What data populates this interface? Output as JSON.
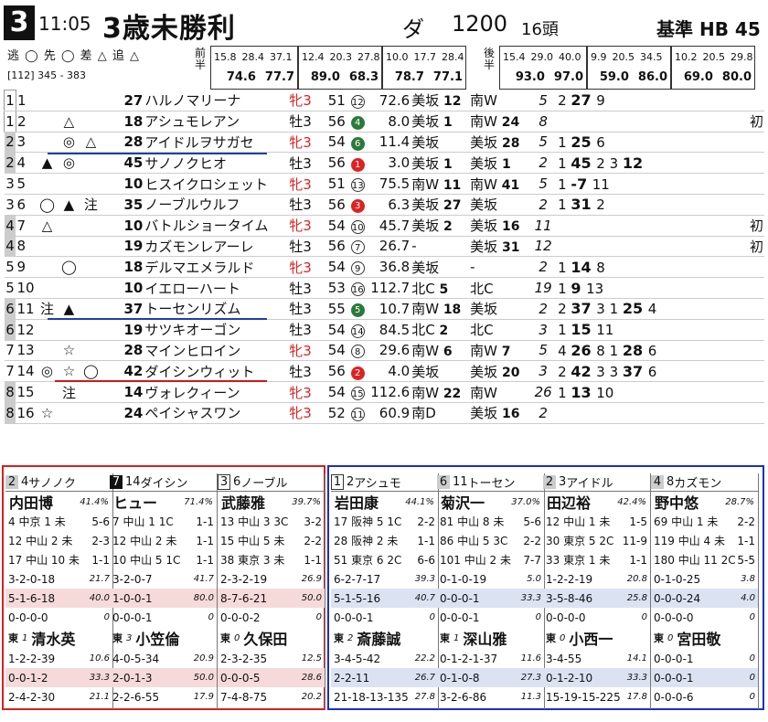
{
  "header": {
    "race_no": "3",
    "time": "11:05",
    "title": "3歳未勝利",
    "course": "ダ",
    "distance": "1200",
    "heads": "16頭",
    "standard": "基準 HB 45",
    "legend": "逃 ◯ 先 ◯ 差 △ 追 △",
    "legend_nums": "[112]  345 - 383",
    "label_zen": "前半",
    "label_kou": "後半"
  },
  "laps_left": [
    {
      "r1": [
        "15.8",
        "28.4",
        "37.1"
      ],
      "r2": [
        "74.6",
        "77.7"
      ]
    },
    {
      "r1": [
        "12.4",
        "20.3",
        "27.8"
      ],
      "r2": [
        "89.0",
        "68.3"
      ]
    },
    {
      "r1": [
        "10.0",
        "17.7",
        "28.4"
      ],
      "r2": [
        "78.7",
        "77.1"
      ]
    }
  ],
  "laps_right": [
    {
      "r1": [
        "15.4",
        "29.0",
        "40.0"
      ],
      "r2": [
        "93.0",
        "97.0"
      ]
    },
    {
      "r1": [
        "9.9",
        "20.5",
        "34.5"
      ],
      "r2": [
        "59.0",
        "86.0"
      ]
    },
    {
      "r1": [
        "10.2",
        "20.5",
        "29.8"
      ],
      "r2": [
        "69.0",
        "80.0"
      ]
    }
  ],
  "runners": [
    {
      "waku": "1",
      "wk": "w1",
      "num": "1",
      "m1": "",
      "m2": "",
      "m3": "",
      "idx": "27",
      "name": "ハルノマリーナ",
      "sex": "牝3",
      "kg": "51",
      "pop": "12",
      "pc": "c",
      "odds": "72.6",
      "trainer": "美坂",
      "t_n": "12",
      "course": "南W",
      "c_n": "",
      "rank": "5",
      "hist": "2 27 9",
      "extra": ""
    },
    {
      "waku": "1",
      "wk": "w1",
      "num": "2",
      "m1": "",
      "m2": "△",
      "m3": "",
      "idx": "18",
      "name": "アシュモレアン",
      "sex": "牡3",
      "kg": "56",
      "pop": "4",
      "pc": "grn",
      "odds": "8.0",
      "trainer": "美坂",
      "t_n": "1",
      "course": "南W",
      "c_n": "24",
      "rank": "8",
      "hist": "",
      "extra": "初"
    },
    {
      "waku": "2",
      "wk": "w2",
      "num": "3",
      "m1": "",
      "m2": "◎",
      "m3": "△",
      "idx": "28",
      "name": "アイドルヲサガセ",
      "sex": "牝3",
      "kg": "54",
      "pop": "6",
      "pc": "grn",
      "odds": "11.4",
      "trainer": "美坂",
      "t_n": "",
      "course": "美坂",
      "c_n": "28",
      "rank": "5",
      "hist": "1 25 6",
      "extra": ""
    },
    {
      "waku": "2",
      "wk": "w2",
      "num": "4",
      "m1": "▲",
      "m2": "◎",
      "m3": "",
      "idx": "45",
      "name": "サノノクヒオ",
      "sex": "牡3",
      "kg": "56",
      "pop": "1",
      "pc": "red",
      "odds": "3.0",
      "trainer": "美坂",
      "t_n": "1",
      "course": "美坂",
      "c_n": "1",
      "rank": "2",
      "hist": "1 45 2 3 12",
      "extra": ""
    },
    {
      "waku": "3",
      "wk": "w3",
      "num": "5",
      "m1": "",
      "m2": "",
      "m3": "",
      "idx": "10",
      "name": "ヒスイクロシェット",
      "sex": "牝3",
      "kg": "51",
      "pop": "13",
      "pc": "c",
      "odds": "75.5",
      "trainer": "南W",
      "t_n": "11",
      "course": "南W",
      "c_n": "41",
      "rank": "5",
      "hist": "1 -7 11",
      "extra": ""
    },
    {
      "waku": "3",
      "wk": "w3",
      "num": "6",
      "m1": "◯",
      "m2": "▲",
      "m3": "注",
      "idx": "35",
      "name": "ノーブルウルフ",
      "sex": "牡3",
      "kg": "56",
      "pop": "3",
      "pc": "red",
      "odds": "6.3",
      "trainer": "美坂",
      "t_n": "27",
      "course": "美坂",
      "c_n": "",
      "rank": "2",
      "hist": "1 31 2",
      "extra": ""
    },
    {
      "waku": "4",
      "wk": "w4",
      "num": "7",
      "m1": "△",
      "m2": "",
      "m3": "",
      "idx": "10",
      "name": "バトルショータイム",
      "sex": "牝3",
      "kg": "54",
      "pop": "10",
      "pc": "c",
      "odds": "45.7",
      "trainer": "美坂",
      "t_n": "2",
      "course": "美坂",
      "c_n": "16",
      "rank": "11",
      "hist": "",
      "extra": "初"
    },
    {
      "waku": "4",
      "wk": "w4",
      "num": "8",
      "m1": "",
      "m2": "",
      "m3": "",
      "idx": "19",
      "name": "カズモンレアーレ",
      "sex": "牡3",
      "kg": "56",
      "pop": "7",
      "pc": "c",
      "odds": "26.7",
      "trainer": "-",
      "t_n": "",
      "course": "美坂",
      "c_n": "31",
      "rank": "12",
      "hist": "",
      "extra": "初"
    },
    {
      "waku": "5",
      "wk": "w5",
      "num": "9",
      "m1": "",
      "m2": "◯",
      "m3": "",
      "idx": "18",
      "name": "デルマエメラルド",
      "sex": "牝3",
      "kg": "54",
      "pop": "9",
      "pc": "c",
      "odds": "36.8",
      "trainer": "美坂",
      "t_n": "",
      "course": "-",
      "c_n": "",
      "rank": "2",
      "hist": "1 14 8",
      "extra": ""
    },
    {
      "waku": "5",
      "wk": "w5",
      "num": "10",
      "m1": "",
      "m2": "",
      "m3": "",
      "idx": "10",
      "name": "イエローハート",
      "sex": "牡3",
      "kg": "53",
      "pop": "16",
      "pc": "c",
      "odds": "112.7",
      "trainer": "北C",
      "t_n": "5",
      "course": "北C",
      "c_n": "",
      "rank": "19",
      "hist": "1 9 13",
      "extra": ""
    },
    {
      "waku": "6",
      "wk": "w6",
      "num": "11",
      "m1": "注",
      "m2": "▲",
      "m3": "",
      "idx": "37",
      "name": "トーセンリズム",
      "sex": "牡3",
      "kg": "55",
      "pop": "5",
      "pc": "grn",
      "odds": "10.7",
      "trainer": "南W",
      "t_n": "18",
      "course": "美坂",
      "c_n": "",
      "rank": "2",
      "hist": "2 37 3 1 25 4",
      "extra": ""
    },
    {
      "waku": "6",
      "wk": "w6",
      "num": "12",
      "m1": "",
      "m2": "",
      "m3": "",
      "idx": "19",
      "name": "サツキオーゴン",
      "sex": "牡3",
      "kg": "54",
      "pop": "14",
      "pc": "c",
      "odds": "84.5",
      "trainer": "北C",
      "t_n": "2",
      "course": "北C",
      "c_n": "",
      "rank": "3",
      "hist": "1 15 11",
      "extra": ""
    },
    {
      "waku": "7",
      "wk": "w7",
      "num": "13",
      "m1": "",
      "m2": "☆",
      "m3": "",
      "idx": "28",
      "name": "マインヒロイン",
      "sex": "牝3",
      "kg": "54",
      "pop": "8",
      "pc": "c",
      "odds": "29.6",
      "trainer": "南W",
      "t_n": "6",
      "course": "南W",
      "c_n": "7",
      "rank": "5",
      "hist": "4 26 8 1 28 6",
      "extra": ""
    },
    {
      "waku": "7",
      "wk": "w7",
      "num": "14",
      "m1": "◎",
      "m2": "☆",
      "m3": "◯",
      "idx": "42",
      "name": "ダイシンウィット",
      "sex": "牡3",
      "kg": "56",
      "pop": "2",
      "pc": "red",
      "odds": "4.0",
      "trainer": "美坂",
      "t_n": "",
      "course": "美坂",
      "c_n": "20",
      "rank": "3",
      "hist": "2 42 3 3 37 6",
      "extra": ""
    },
    {
      "waku": "8",
      "wk": "w8",
      "num": "15",
      "m1": "",
      "m2": "注",
      "m3": "",
      "idx": "14",
      "name": "ヴォレクィーン",
      "sex": "牝3",
      "kg": "54",
      "pop": "15",
      "pc": "c",
      "odds": "112.6",
      "trainer": "南W",
      "t_n": "22",
      "course": "南W",
      "c_n": "",
      "rank": "26",
      "hist": "1 13 10",
      "extra": ""
    },
    {
      "waku": "8",
      "wk": "w8",
      "num": "16",
      "m1": "☆",
      "m2": "",
      "m3": "",
      "idx": "24",
      "name": "ペイシャスワン",
      "sex": "牝3",
      "kg": "52",
      "pop": "11",
      "pc": "c",
      "odds": "60.9",
      "trainer": "南D",
      "t_n": "",
      "course": "美坂",
      "c_n": "16",
      "rank": "2",
      "hist": "",
      "extra": ""
    }
  ],
  "jockeys": [
    {
      "wk": "2",
      "wkcls": "gy",
      "num": "4",
      "horse": "サノノク",
      "name": "内田博",
      "pct": "41.4%",
      "l1": [
        "4",
        "中京",
        "1",
        "未",
        "5-6"
      ],
      "l2": [
        "12",
        "中山",
        "2",
        "未",
        "2-3"
      ],
      "l3": [
        "17",
        "中山",
        "10",
        "未",
        "1-1"
      ],
      "s1": "3-2-0-18",
      "s1p": "21.7",
      "s2": "5-1-6-18",
      "s2p": "40.0",
      "s3": "0-0-0-0",
      "s3p": "0",
      "trn_l": "東",
      "trn_n": "1",
      "trn": "清水英",
      "t1": "1-2-2-39",
      "t1p": "10.6",
      "t2": "0-0-1-2",
      "t2p": "33.3",
      "t3": "2-4-2-30",
      "t3p": "21.1"
    },
    {
      "wk": "7",
      "wkcls": "bk",
      "num": "14",
      "horse": "ダイシン",
      "name": "ヒュー",
      "pct": "71.4%",
      "l1": [
        "7",
        "中山",
        "1",
        "1C",
        "1-1"
      ],
      "l2": [
        "12",
        "中山",
        "2",
        "未",
        "1-1"
      ],
      "l3": [
        "10",
        "中山",
        "5",
        "1C",
        "1-1"
      ],
      "s1": "3-2-0-7",
      "s1p": "41.7",
      "s2": "1-0-0-1",
      "s2p": "80.0",
      "s3": "0-0-0-1",
      "s3p": "0",
      "trn_l": "東",
      "trn_n": "3",
      "trn": "小笠倫",
      "t1": "4-0-5-34",
      "t1p": "20.9",
      "t2": "2-0-1-3",
      "t2p": "50.0",
      "t3": "2-2-6-55",
      "t3p": "17.9"
    },
    {
      "wk": "3",
      "wkcls": "bx",
      "num": "6",
      "horse": "ノーブル",
      "name": "武藤雅",
      "pct": "39.7%",
      "l1": [
        "13",
        "中山",
        "3",
        "3C",
        "3-2"
      ],
      "l2": [
        "15",
        "中山",
        "5",
        "未",
        "2-2"
      ],
      "l3": [
        "38",
        "東京",
        "3",
        "未",
        "1-1"
      ],
      "s1": "2-3-2-19",
      "s1p": "26.9",
      "s2": "8-7-6-21",
      "s2p": "50.0",
      "s3": "0-0-0-2",
      "s3p": "0",
      "trn_l": "東",
      "trn_n": "0",
      "trn": "久保田",
      "t1": "2-3-2-35",
      "t1p": "12.5",
      "t2": "0-0-0-5",
      "t2p": "28.6",
      "t3": "7-4-8-75",
      "t3p": "20.2"
    },
    {
      "wk": "1",
      "wkcls": "bx",
      "num": "2",
      "horse": "アシュモ",
      "name": "岩田康",
      "pct": "44.1%",
      "l1": [
        "17",
        "阪神",
        "5",
        "1C",
        "2-2"
      ],
      "l2": [
        "28",
        "阪神",
        "2",
        "未",
        "1-1"
      ],
      "l3": [
        "51",
        "東京",
        "6",
        "2C",
        "6-6"
      ],
      "s1": "6-2-7-17",
      "s1p": "39.3",
      "s2": "5-1-5-16",
      "s2p": "40.7",
      "s3": "0-0-0-1",
      "s3p": "0",
      "trn_l": "東",
      "trn_n": "2",
      "trn": "斎藤誠",
      "t1": "3-4-5-42",
      "t1p": "22.2",
      "t2": "2-2-11",
      "t2p": "26.7",
      "t3": "21-18-13-135",
      "t3p": "27.8"
    },
    {
      "wk": "6",
      "wkcls": "gy",
      "num": "11",
      "horse": "トーセン",
      "name": "菊沢一",
      "pct": "37.0%",
      "l1": [
        "81",
        "中山",
        "8",
        "未",
        "5-6"
      ],
      "l2": [
        "86",
        "中山",
        "5",
        "3C",
        "2-2"
      ],
      "l3": [
        "101",
        "中山",
        "2",
        "未",
        "7-7"
      ],
      "s1": "0-1-0-19",
      "s1p": "5.0",
      "s2": "0-0-0-1",
      "s2p": "33.3",
      "s3": "0-0-0-1",
      "s3p": "0",
      "trn_l": "東",
      "trn_n": "1",
      "trn": "深山雅",
      "t1": "0-1-2-1-37",
      "t1p": "11.6",
      "t2": "0-1-0-8",
      "t2p": "27.3",
      "t3": "3-2-6-86",
      "t3p": "11.3"
    },
    {
      "wk": "2",
      "wkcls": "gy",
      "num": "3",
      "horse": "アイドル",
      "name": "田辺裕",
      "pct": "42.4%",
      "l1": [
        "12",
        "中山",
        "1",
        "未",
        "1-5"
      ],
      "l2": [
        "30",
        "東京",
        "5",
        "2C",
        "11-9"
      ],
      "l3": [
        "33",
        "東京",
        "1",
        "未",
        "1-1"
      ],
      "s1": "1-2-2-19",
      "s1p": "20.8",
      "s2": "3-5-8-46",
      "s2p": "25.8",
      "s3": "0-0-0-0",
      "s3p": "0",
      "trn_l": "東",
      "trn_n": "0",
      "trn": "小西一",
      "t1": "3-4-55",
      "t1p": "14.1",
      "t2": "0-1-2-10",
      "t2p": "33.3",
      "t3": "15-19-15-225",
      "t3p": "17.8"
    },
    {
      "wk": "4",
      "wkcls": "gy",
      "num": "8",
      "horse": "カズモン",
      "name": "野中悠",
      "pct": "28.7%",
      "l1": [
        "69",
        "中山",
        "1",
        "未",
        "2-2"
      ],
      "l2": [
        "119",
        "中山",
        "4",
        "未",
        "1-1"
      ],
      "l3": [
        "180",
        "中山",
        "11",
        "2C",
        "5-5"
      ],
      "s1": "0-1-0-25",
      "s1p": "3.8",
      "s2": "0-0-0-24",
      "s2p": "4.0",
      "s3": "0-0-0-0",
      "s3p": "0",
      "trn_l": "東",
      "trn_n": "0",
      "trn": "宮田敬",
      "t1": "0-0-0-1",
      "t1p": "0",
      "t2": "0-0-0-1",
      "t2p": "0",
      "t3": "0-0-0-6",
      "t3p": "0"
    }
  ]
}
